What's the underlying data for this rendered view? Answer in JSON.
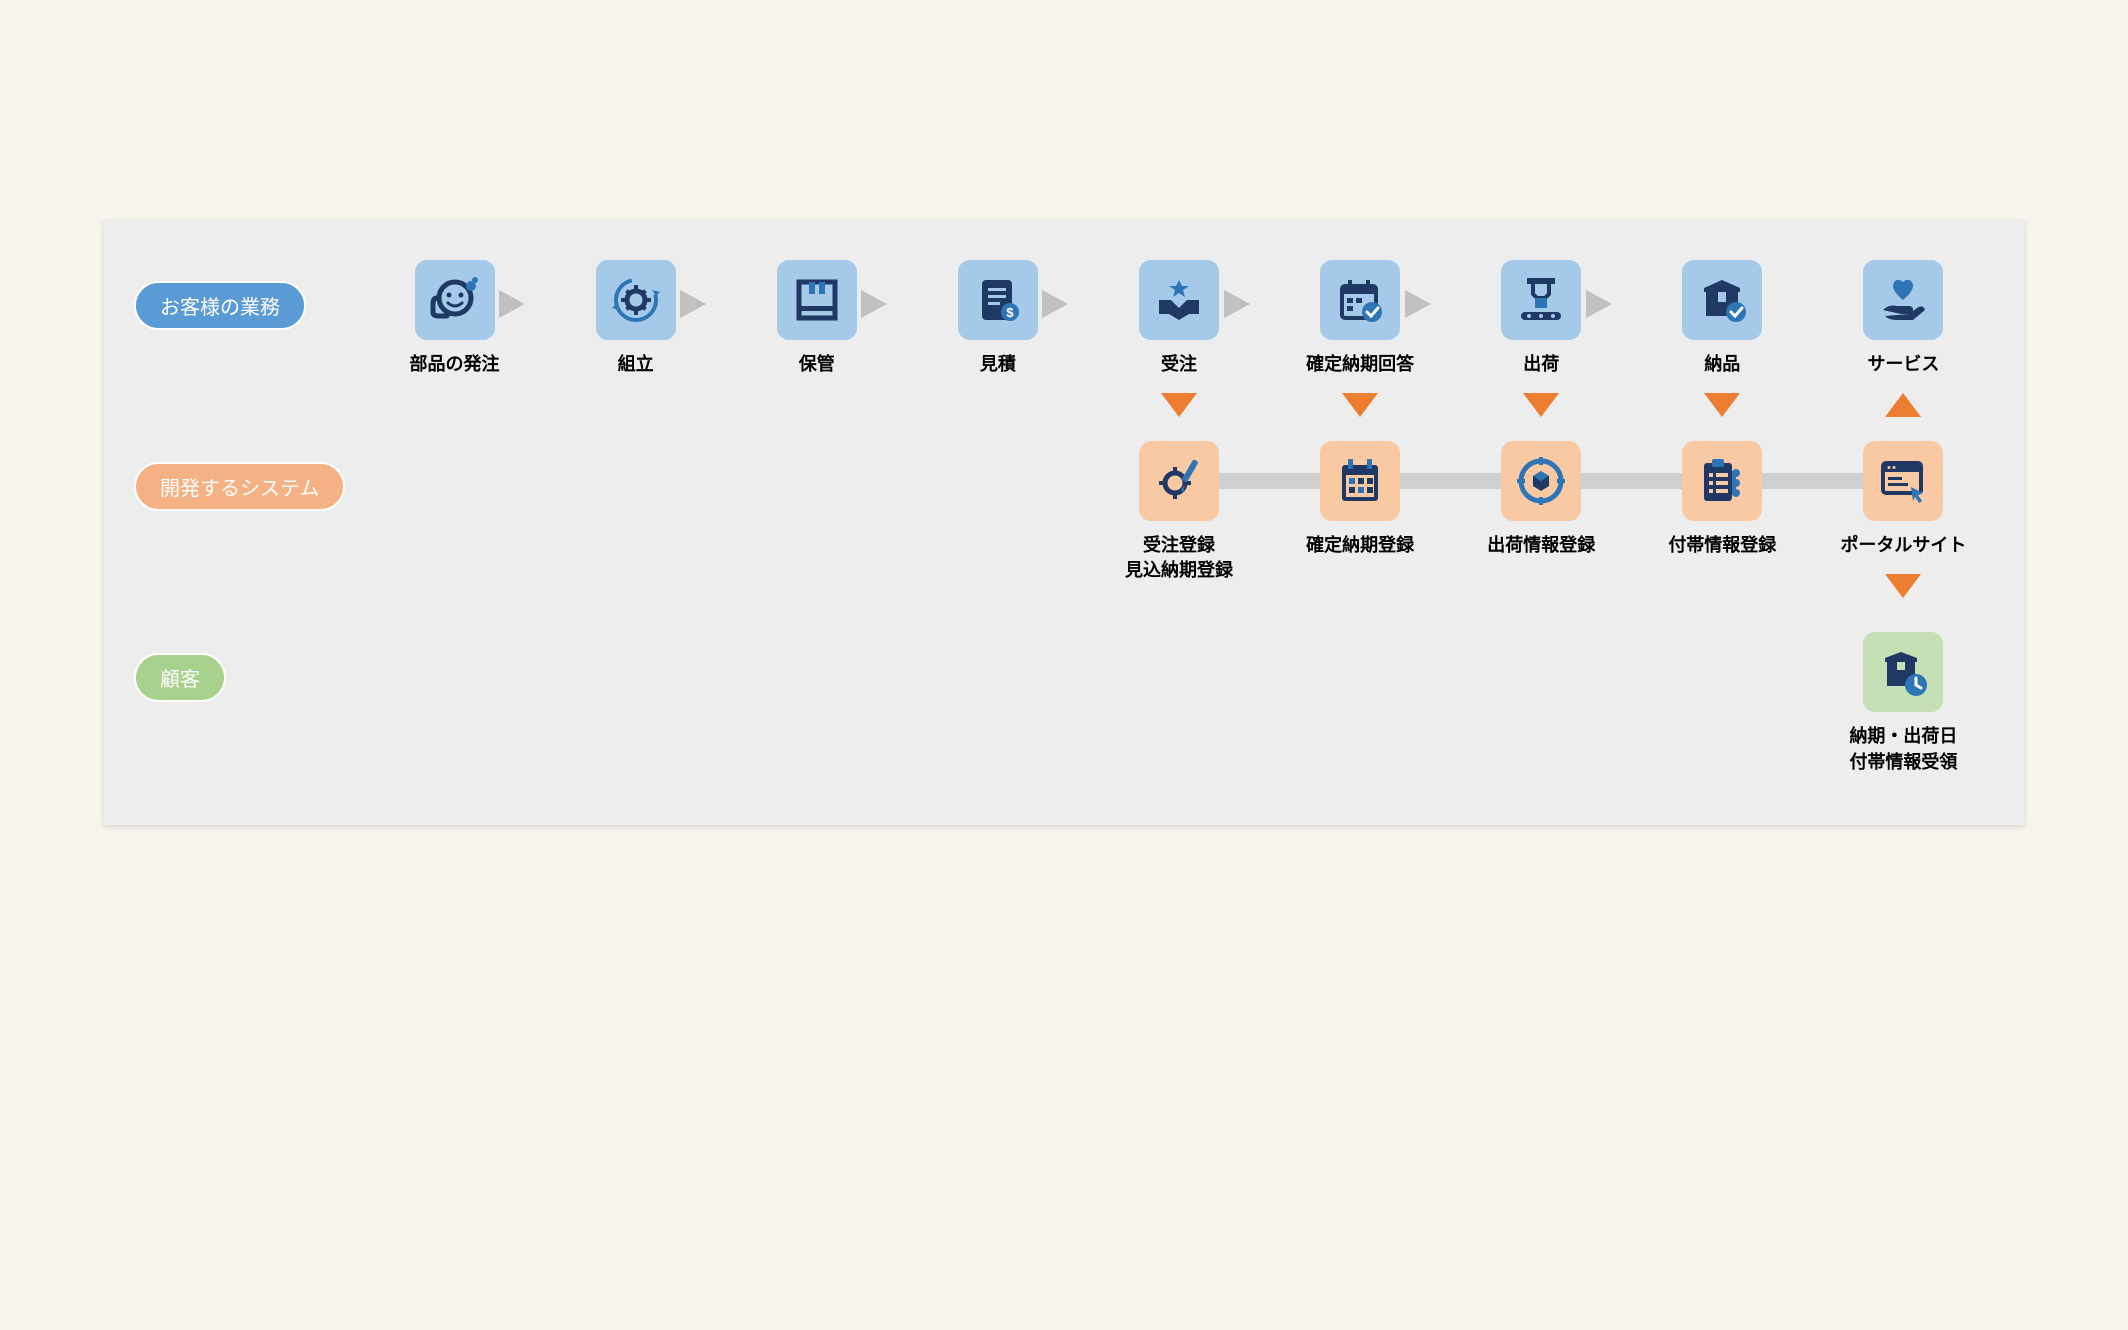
{
  "rows": {
    "customer_business": {
      "label": "お客様の業務"
    },
    "system_to_develop": {
      "label": "開発するシステム"
    },
    "customer": {
      "label": "顧客"
    }
  },
  "business_steps": [
    {
      "label": "部品の発注",
      "icon": "support"
    },
    {
      "label": "組立",
      "icon": "gear-cycle"
    },
    {
      "label": "保管",
      "icon": "warehouse"
    },
    {
      "label": "見積",
      "icon": "invoice"
    },
    {
      "label": "受注",
      "icon": "handshake"
    },
    {
      "label": "確定納期回答",
      "icon": "calendar-check"
    },
    {
      "label": "出荷",
      "icon": "conveyor"
    },
    {
      "label": "納品",
      "icon": "box-check"
    },
    {
      "label": "サービス",
      "icon": "care"
    }
  ],
  "system_steps": [
    {
      "label": "受注登録\n見込納期登録",
      "icon": "gear-pencil"
    },
    {
      "label": "確定納期登録",
      "icon": "calendar-boxes"
    },
    {
      "label": "出荷情報登録",
      "icon": "target-box"
    },
    {
      "label": "付帯情報登録",
      "icon": "checklist-plus"
    },
    {
      "label": "ポータルサイト",
      "icon": "browser-click"
    }
  ],
  "customer_step": {
    "label": "納期・出荷日\n付帯情報受領",
    "icon": "package-clock"
  },
  "colors": {
    "icon_dark": "#1f3864",
    "icon_accent": "#2e75b6",
    "arrow_orange": "#ed7d31"
  }
}
